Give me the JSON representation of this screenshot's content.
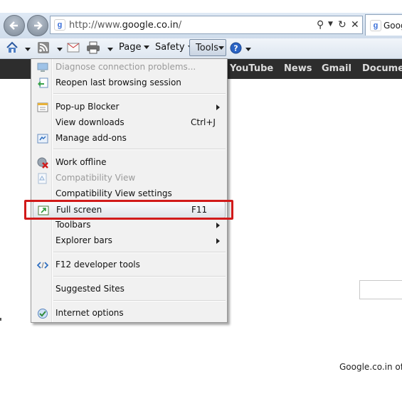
{
  "browser": {
    "url_prefix": "http://www.",
    "url_domain": "google.co.in",
    "url_suffix": "/",
    "tab_title": "Goog",
    "favicon_letter": "g"
  },
  "commandbar": {
    "page_label": "Page",
    "safety_label": "Safety",
    "tools_label": "Tools"
  },
  "google_bar": {
    "links": [
      "YouTube",
      "News",
      "Gmail",
      "Documen"
    ]
  },
  "page": {
    "footer_text": "Google.co.in of"
  },
  "tools_menu": {
    "items": [
      {
        "label": "Diagnose connection problems...",
        "disabled": true
      },
      {
        "label": "Reopen last browsing session"
      },
      {
        "label": "Pop-up Blocker",
        "submenu": true
      },
      {
        "label": "View downloads",
        "shortcut": "Ctrl+J"
      },
      {
        "label": "Manage add-ons"
      },
      {
        "label": "Work offline"
      },
      {
        "label": "Compatibility View",
        "disabled": true
      },
      {
        "label": "Compatibility View settings"
      },
      {
        "label": "Full screen",
        "shortcut": "F11",
        "highlighted": true
      },
      {
        "label": "Toolbars",
        "submenu": true
      },
      {
        "label": "Explorer bars",
        "submenu": true
      },
      {
        "label": "F12 developer tools"
      },
      {
        "label": "Suggested Sites"
      },
      {
        "label": "Internet options"
      }
    ]
  },
  "colors": {
    "highlight_box": "#d11a1a",
    "google_bar": "#2d2d2d"
  }
}
